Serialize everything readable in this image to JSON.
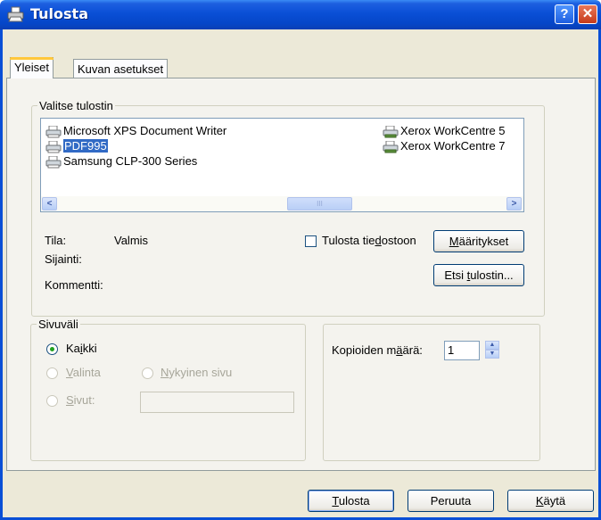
{
  "window": {
    "title": "Tulosta",
    "help_glyph": "?",
    "close_glyph": "✕"
  },
  "tabs": [
    {
      "label": "Yleiset"
    },
    {
      "label": "Kuvan asetukset"
    }
  ],
  "printer_group": {
    "legend": "Valitse tulostin",
    "printers": [
      {
        "name": "Microsoft XPS Document Writer",
        "selected": false
      },
      {
        "name": "PDF995",
        "selected": true
      },
      {
        "name": "Samsung CLP-300 Series",
        "selected": false
      },
      {
        "name": "Xerox WorkCentre 5",
        "selected": false
      },
      {
        "name": "Xerox WorkCentre 7",
        "selected": false
      }
    ],
    "scroll_left": "<",
    "scroll_right": ">",
    "scroll_thumb_grip": "III"
  },
  "status": {
    "state_label": "Tila:",
    "state_value": "Valmis",
    "location_label": "Sijainti:",
    "comment_label": "Kommentti:"
  },
  "print_to_file": {
    "label_pre": "Tulosta tie",
    "label_hot": "d",
    "label_post": "ostoon",
    "checked": false
  },
  "buttons": {
    "properties": {
      "pre": "",
      "hot": "M",
      "post": "ääritykset"
    },
    "find_printer": {
      "pre": "Etsi ",
      "hot": "t",
      "post": "ulostin..."
    },
    "print": {
      "pre": "",
      "hot": "T",
      "post": "ulosta"
    },
    "cancel": {
      "label": "Peruuta"
    },
    "apply": {
      "pre": "",
      "hot": "K",
      "post": "äytä"
    }
  },
  "range_group": {
    "legend": "Sivuväli",
    "all": {
      "pre": "Ka",
      "hot": "i",
      "post": "kki",
      "selected": true
    },
    "selection": {
      "pre": "",
      "hot": "V",
      "post": "alinta"
    },
    "current_page": {
      "pre": "",
      "hot": "N",
      "post": "ykyinen sivu"
    },
    "pages": {
      "pre": "",
      "hot": "S",
      "post": "ivut:"
    },
    "pages_value": ""
  },
  "copies": {
    "label_pre": "Kopioiden m",
    "label_hot": "ä",
    "label_post": "ärä:",
    "value": "1"
  },
  "colors": {
    "titlebar": "#0a4fd6",
    "selection": "#316ac5",
    "dialog_bg": "#ece9d8"
  }
}
